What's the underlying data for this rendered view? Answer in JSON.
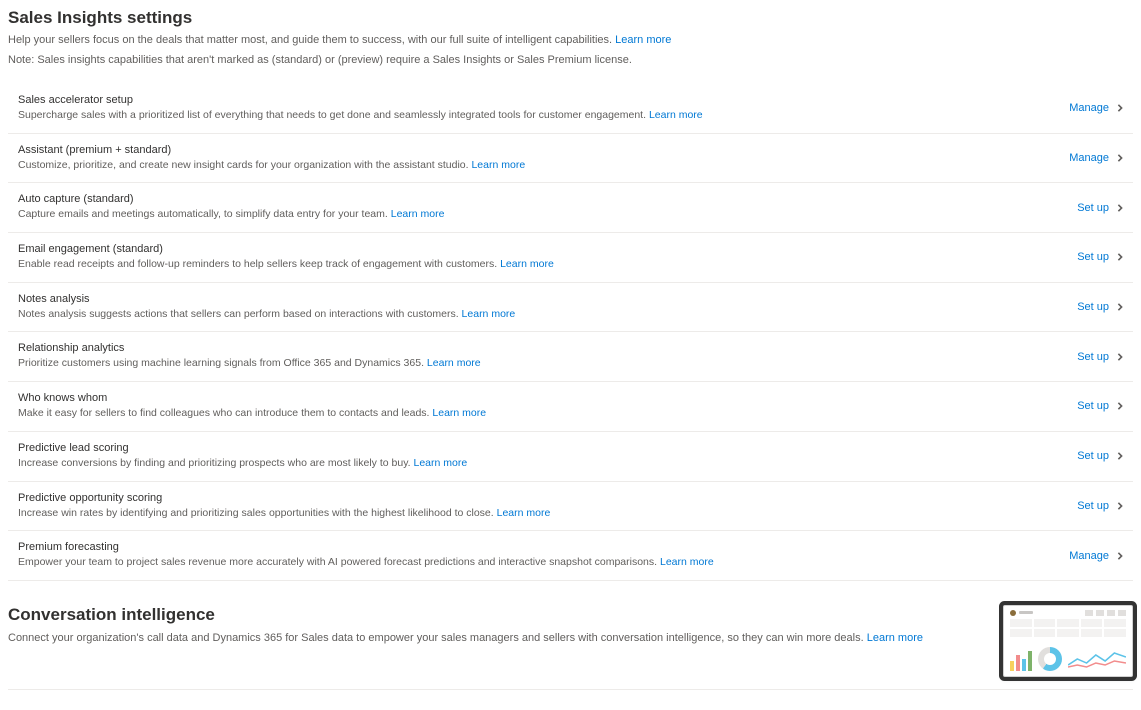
{
  "header": {
    "title": "Sales Insights settings",
    "subtitle": "Help your sellers focus on the deals that matter most, and guide them to success, with our full suite of intelligent capabilities.",
    "learn_more": "Learn more",
    "note": "Note: Sales insights capabilities that aren't marked as (standard) or (preview) require a Sales Insights or Sales Premium license."
  },
  "actions": {
    "manage": "Manage",
    "setup": "Set up",
    "learn_more": "Learn more"
  },
  "settings": [
    {
      "id": "sales-accelerator",
      "title": "Sales accelerator setup",
      "desc": "Supercharge sales with a prioritized list of everything that needs to get done and seamlessly integrated tools for customer engagement.",
      "action": "manage"
    },
    {
      "id": "assistant",
      "title": "Assistant (premium + standard)",
      "desc": "Customize, prioritize, and create new insight cards for your organization with the assistant studio.",
      "action": "manage"
    },
    {
      "id": "auto-capture",
      "title": "Auto capture (standard)",
      "desc": "Capture emails and meetings automatically, to simplify data entry for your team.",
      "action": "setup"
    },
    {
      "id": "email-engagement",
      "title": "Email engagement (standard)",
      "desc": "Enable read receipts and follow-up reminders to help sellers keep track of engagement with customers.",
      "action": "setup"
    },
    {
      "id": "notes-analysis",
      "title": "Notes analysis",
      "desc": "Notes analysis suggests actions that sellers can perform based on interactions with customers.",
      "action": "setup"
    },
    {
      "id": "relationship-analytics",
      "title": "Relationship analytics",
      "desc": "Prioritize customers using machine learning signals from Office 365 and Dynamics 365.",
      "action": "setup"
    },
    {
      "id": "who-knows-whom",
      "title": "Who knows whom",
      "desc": "Make it easy for sellers to find colleagues who can introduce them to contacts and leads.",
      "action": "setup"
    },
    {
      "id": "predictive-lead-scoring",
      "title": "Predictive lead scoring",
      "desc": "Increase conversions by finding and prioritizing prospects who are most likely to buy.",
      "action": "setup"
    },
    {
      "id": "predictive-opportunity-scoring",
      "title": "Predictive opportunity scoring",
      "desc": "Increase win rates by identifying and prioritizing sales opportunities with the highest likelihood to close.",
      "action": "setup"
    },
    {
      "id": "premium-forecasting",
      "title": "Premium forecasting",
      "desc": "Empower your team to project sales revenue more accurately with AI powered forecast predictions and interactive snapshot comparisons.",
      "action": "manage"
    }
  ],
  "conversation": {
    "title": "Conversation intelligence",
    "desc": "Connect your organization's call data and Dynamics 365 for Sales data to empower your sales managers and sellers with conversation intelligence, so they can win more deals.",
    "learn_more": "Learn more"
  }
}
